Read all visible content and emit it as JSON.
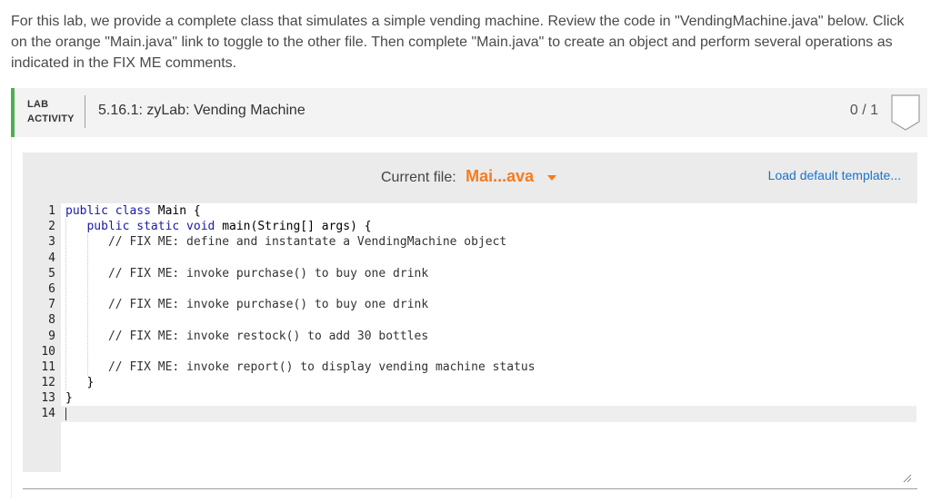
{
  "intro": {
    "text": "For this lab, we provide a complete class that simulates a simple vending machine. Review the code in \"VendingMachine.java\" below. Click on the orange \"Main.java\" link to toggle to the other file. Then complete \"Main.java\" to create an object and perform several operations as indicated in the FIX ME comments."
  },
  "lab": {
    "tag_line1": "LAB",
    "tag_line2": "ACTIVITY",
    "title": "5.16.1: zyLab: Vending Machine",
    "score": "0 / 1",
    "accent_color": "#4caf50"
  },
  "editor": {
    "current_file_label": "Current file:",
    "current_file_name": "Mai...ava",
    "load_default_label": "Load default template...",
    "file_link_color": "#f47c20",
    "link_color": "#1a73c8",
    "line_numbers": [
      "1",
      "2",
      "3",
      "4",
      "5",
      "6",
      "7",
      "8",
      "9",
      "10",
      "11",
      "12",
      "13",
      "14"
    ],
    "code_lines": [
      {
        "kw": "public class ",
        "text": "Main {"
      },
      {
        "indent": "   ",
        "kw": "public static void ",
        "text": "main(String[] args) {"
      },
      {
        "indent": "      ",
        "comment": "// FIX ME: define and instantate a VendingMachine object"
      },
      {
        "text": ""
      },
      {
        "indent": "      ",
        "comment": "// FIX ME: invoke purchase() to buy one drink"
      },
      {
        "text": ""
      },
      {
        "indent": "      ",
        "comment": "// FIX ME: invoke purchase() to buy one drink"
      },
      {
        "text": ""
      },
      {
        "indent": "      ",
        "comment": "// FIX ME: invoke restock() to add 30 bottles"
      },
      {
        "text": ""
      },
      {
        "indent": "      ",
        "comment": "// FIX ME: invoke report() to display vending machine status"
      },
      {
        "indent": "   ",
        "text": "}"
      },
      {
        "text": "}"
      },
      {
        "text": "",
        "active": true
      }
    ]
  }
}
